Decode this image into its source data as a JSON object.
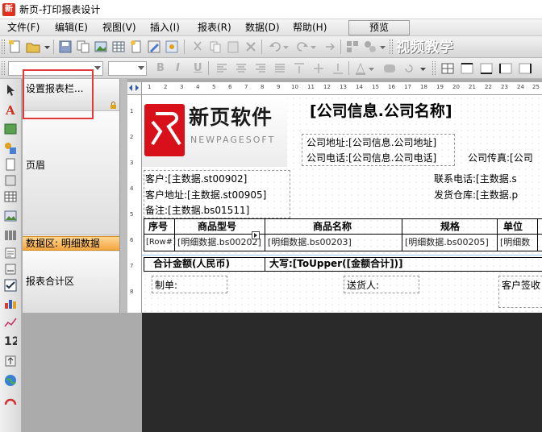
{
  "window": {
    "title": "新页-打印报表设计"
  },
  "menu": {
    "items": [
      "文件(F)",
      "编辑(E)",
      "视图(V)",
      "插入(I)",
      "报表(R)",
      "数据(D)",
      "帮助(H)"
    ],
    "preview": "预览"
  },
  "toolbar": {
    "video_label": "视频教学"
  },
  "format_toolbar": {
    "bold": "B",
    "italic": "I",
    "underline": "U"
  },
  "bands": {
    "settings": "设置报表栏...",
    "header": "页眉",
    "data": "数据区: 明细数据",
    "footer_total": "报表合计区"
  },
  "rulers": {
    "horizontal": [
      "1",
      "2",
      "3",
      "4",
      "5",
      "6",
      "7",
      "8",
      "9",
      "10",
      "11",
      "12",
      "13",
      "14",
      "15",
      "16",
      "17",
      "18",
      "19",
      "20",
      "21",
      "22",
      "23",
      "24",
      "25"
    ],
    "vertical": [
      "1",
      "2",
      "3",
      "4",
      "5",
      "6",
      "7",
      "8"
    ]
  },
  "report": {
    "logo_title": "新页软件",
    "logo_subtitle": "NEWPAGESOFT",
    "company_name": "[公司信息.公司名称]",
    "company_address": "公司地址:[公司信息.公司地址]",
    "company_phone": "公司电话:[公司信息.公司电话]",
    "company_fax": "公司传真:[公司",
    "customer": "客户:[主数据.st00902]",
    "customer_address": "客户地址:[主数据.st00905]",
    "remark": "备注:[主数据.bs01511]",
    "contact_phone": "联系电话:[主数据.s",
    "warehouse": "发货仓库:[主数据.p",
    "columns": [
      "序号",
      "商品型号",
      "商品名称",
      "规格",
      "单位"
    ],
    "row": [
      "[Row#]",
      "[明细数据.bs00202]",
      "[明细数据.bs00203]",
      "[明细数据.bs00205]",
      "[明细数"
    ],
    "total_label": "合计金额(人民币)",
    "total_value": "大写:[ToUpper([金额合计])]",
    "maker": "制单:",
    "deliverer": "送货人:",
    "customer_sign": "客户签收"
  }
}
